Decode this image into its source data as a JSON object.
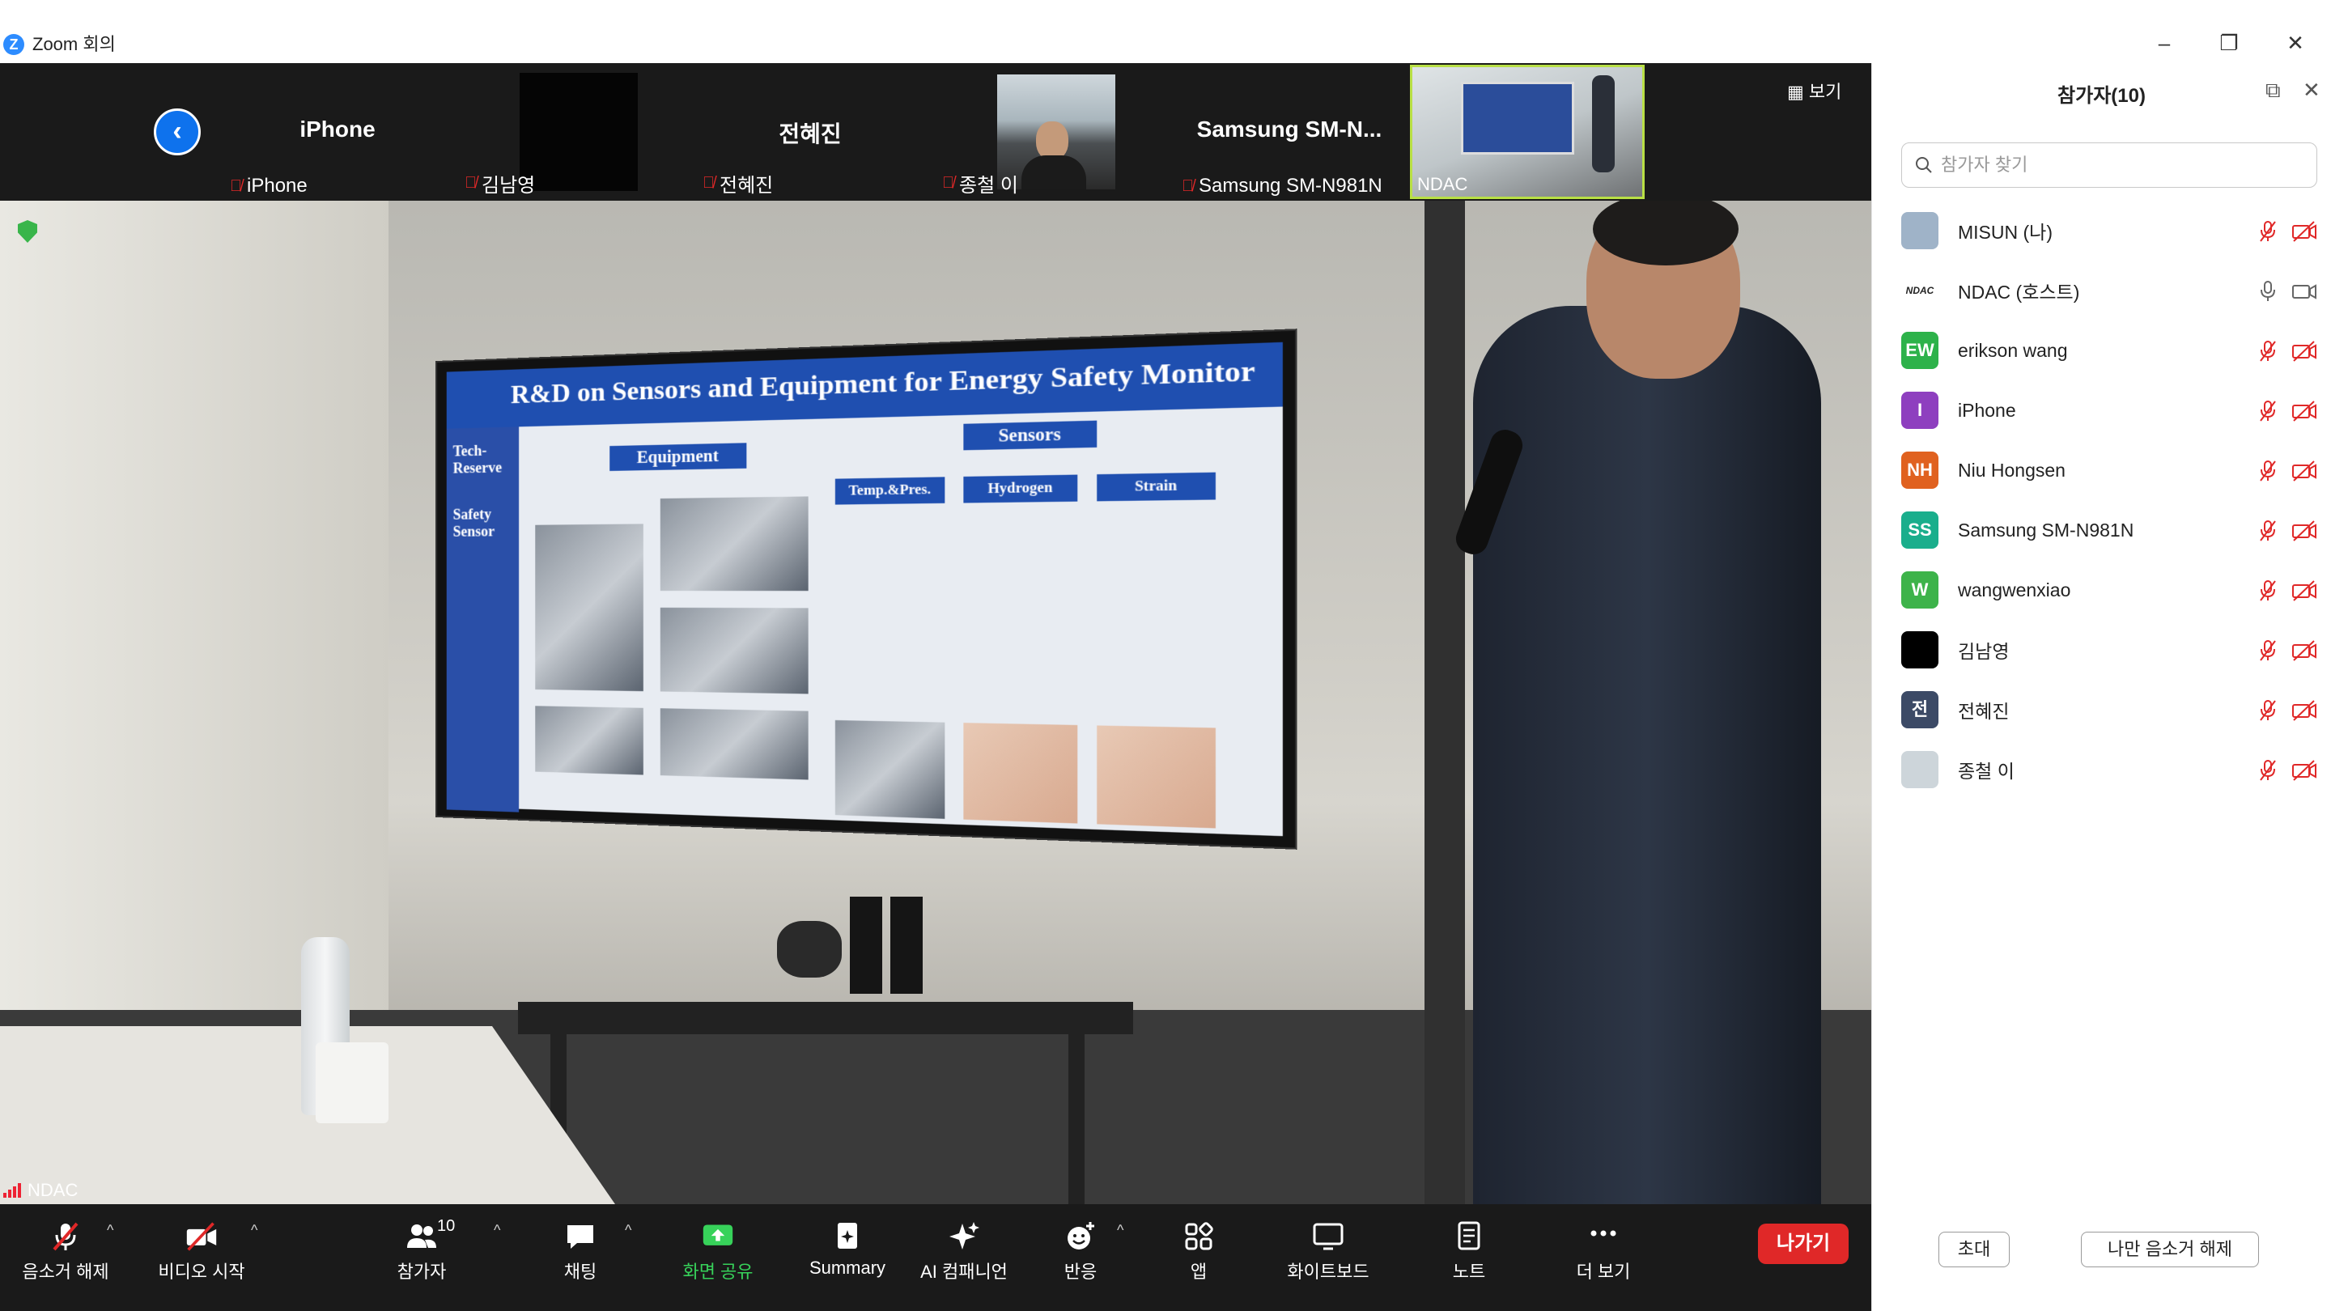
{
  "window": {
    "title": "Zoom 회의",
    "app_icon": "Z"
  },
  "strip": {
    "tiles": [
      {
        "big": "iPhone",
        "label": "iPhone"
      },
      {
        "big": "",
        "label": "김남영"
      },
      {
        "big": "전혜진",
        "label": "전혜진"
      },
      {
        "big": "",
        "label": "종철 이"
      },
      {
        "big": "Samsung  SM-N...",
        "label": "Samsung SM-N981N"
      },
      {
        "big": "",
        "label": "NDAC"
      }
    ],
    "view_label": "보기"
  },
  "main_video": {
    "speaker_name": "NDAC",
    "slide": {
      "title": "R&D on Sensors and Equipment for Energy Safety Monitor",
      "side1": "Tech-Reserve",
      "side2": "Safety Sensor",
      "equipment": "Equipment",
      "sensors": "Sensors",
      "temp": "Temp.&Pres.",
      "hydrogen": "Hydrogen",
      "strain": "Strain"
    }
  },
  "toolbar": {
    "mute": "음소거 해제",
    "video": "비디오 시작",
    "participants": "참가자",
    "participants_count": "10",
    "chat": "채팅",
    "share": "화면 공유",
    "summary": "Summary",
    "ai": "AI 컴패니언",
    "reactions": "반응",
    "apps": "앱",
    "whiteboard": "화이트보드",
    "notes": "노트",
    "more": "더 보기",
    "leave": "나가기"
  },
  "panel": {
    "title": "참가자(10)",
    "search_placeholder": "참가자 찾기",
    "participants": [
      {
        "name": "MISUN (나)",
        "initials": "",
        "color": "#9fb3c8",
        "mic": "off",
        "cam": "off"
      },
      {
        "name": "NDAC (호스트)",
        "initials": "NDAC",
        "color": "#ffffff",
        "mic": "on",
        "cam": "on"
      },
      {
        "name": "erikson wang",
        "initials": "EW",
        "color": "#2DB24A",
        "mic": "off",
        "cam": "off"
      },
      {
        "name": "iPhone",
        "initials": "I",
        "color": "#8E3FBF",
        "mic": "off",
        "cam": "off"
      },
      {
        "name": "Niu Hongsen",
        "initials": "NH",
        "color": "#E0611F",
        "mic": "off",
        "cam": "off"
      },
      {
        "name": "Samsung SM-N981N",
        "initials": "SS",
        "color": "#1AAE8C",
        "mic": "off",
        "cam": "off"
      },
      {
        "name": "wangwenxiao",
        "initials": "W",
        "color": "#3DB34A",
        "mic": "off",
        "cam": "off"
      },
      {
        "name": "김남영",
        "initials": "",
        "color": "#000000",
        "mic": "off",
        "cam": "off"
      },
      {
        "name": "전혜진",
        "initials": "전",
        "color": "#3C4A66",
        "mic": "off",
        "cam": "off"
      },
      {
        "name": "종철 이",
        "initials": "",
        "color": "#cdd5da",
        "mic": "off",
        "cam": "off"
      }
    ],
    "invite": "초대",
    "unmute_me": "나만 음소거 해제"
  },
  "colors": {
    "accent": "#0E72ED",
    "leave": "#E02828",
    "muted": "#E02828",
    "share": "#37D25A",
    "active_border": "#B9E045"
  }
}
